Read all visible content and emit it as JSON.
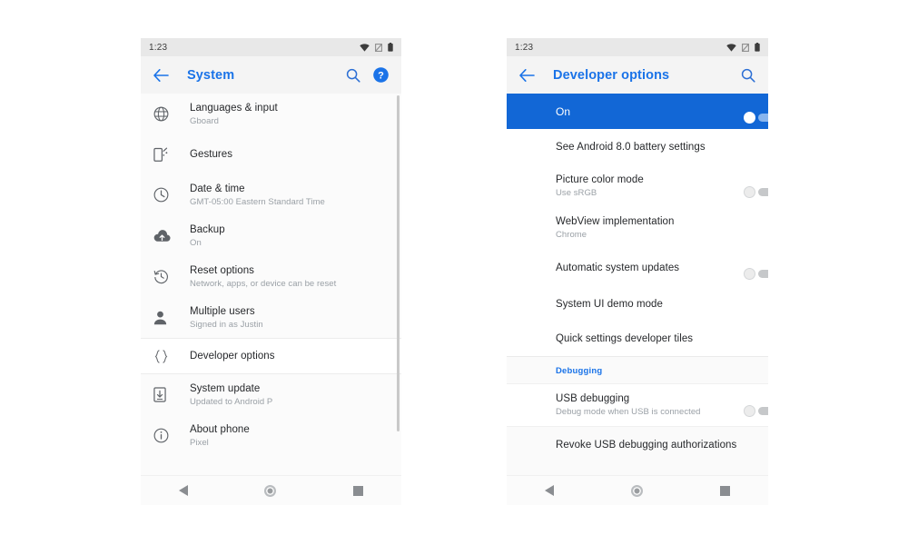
{
  "phones": [
    {
      "id": "system-settings",
      "status_bar": {
        "clock": "1:23",
        "icons": [
          "wifi-icon",
          "sim-off-icon",
          "battery-icon"
        ]
      },
      "toolbar": {
        "back_icon": "back-arrow-icon",
        "title": "System",
        "actions": [
          "search-icon",
          "help-icon"
        ]
      },
      "rows": [
        {
          "icon": "language-globe-icon",
          "title": "Languages & input",
          "sub": "Gboard"
        },
        {
          "icon": "gestures-icon",
          "title": "Gestures",
          "sub": ""
        },
        {
          "icon": "clock-icon",
          "title": "Date & time",
          "sub": "GMT-05:00 Eastern Standard Time"
        },
        {
          "icon": "backup-cloud-icon",
          "title": "Backup",
          "sub": "On"
        },
        {
          "icon": "reset-history-icon",
          "title": "Reset options",
          "sub": "Network, apps, or device can be reset"
        },
        {
          "icon": "person-icon",
          "title": "Multiple users",
          "sub": "Signed in as Justin"
        },
        {
          "icon": "developer-braces-icon",
          "title": "Developer options",
          "sub": "",
          "highlighted": true
        },
        {
          "icon": "system-update-icon",
          "title": "System update",
          "sub": "Updated to Android P"
        },
        {
          "icon": "info-circle-icon",
          "title": "About phone",
          "sub": "Pixel"
        }
      ],
      "nav_bar": [
        "back-nav-icon",
        "home-nav-icon",
        "recents-nav-icon"
      ]
    },
    {
      "id": "developer-options",
      "status_bar": {
        "clock": "1:23",
        "icons": [
          "wifi-icon",
          "sim-off-icon",
          "battery-icon"
        ]
      },
      "toolbar": {
        "back_icon": "back-arrow-icon",
        "title": "Developer options",
        "actions": [
          "search-icon"
        ]
      },
      "master_switch": {
        "label": "On",
        "state": "on"
      },
      "rows": [
        {
          "title": "See Android 8.0 battery settings",
          "sub": "",
          "toggle": null
        },
        {
          "title": "Picture color mode",
          "sub": "Use sRGB",
          "toggle": "off"
        },
        {
          "title": "WebView implementation",
          "sub": "Chrome",
          "toggle": null
        },
        {
          "title": "Automatic system updates",
          "sub": "",
          "toggle": "off"
        },
        {
          "title": "System UI demo mode",
          "sub": "",
          "toggle": null
        },
        {
          "title": "Quick settings developer tiles",
          "sub": "",
          "toggle": null
        }
      ],
      "section": {
        "label": "Debugging"
      },
      "debug_rows": [
        {
          "title": "USB debugging",
          "sub": "Debug mode when USB is connected",
          "toggle": "off",
          "highlighted": true
        },
        {
          "title": "Revoke USB debugging authorizations",
          "sub": "",
          "toggle": null
        }
      ],
      "nav_bar": [
        "back-nav-icon",
        "home-nav-icon",
        "recents-nav-icon"
      ]
    }
  ],
  "colors": {
    "accent_blue": "#1a73e8",
    "master_switch_blue": "#1267d6",
    "toolbar_bg": "#f4f4f4",
    "status_bar_bg": "#e8e8e8",
    "primary_text": "#26282b",
    "secondary_text": "#9aa0a6"
  }
}
